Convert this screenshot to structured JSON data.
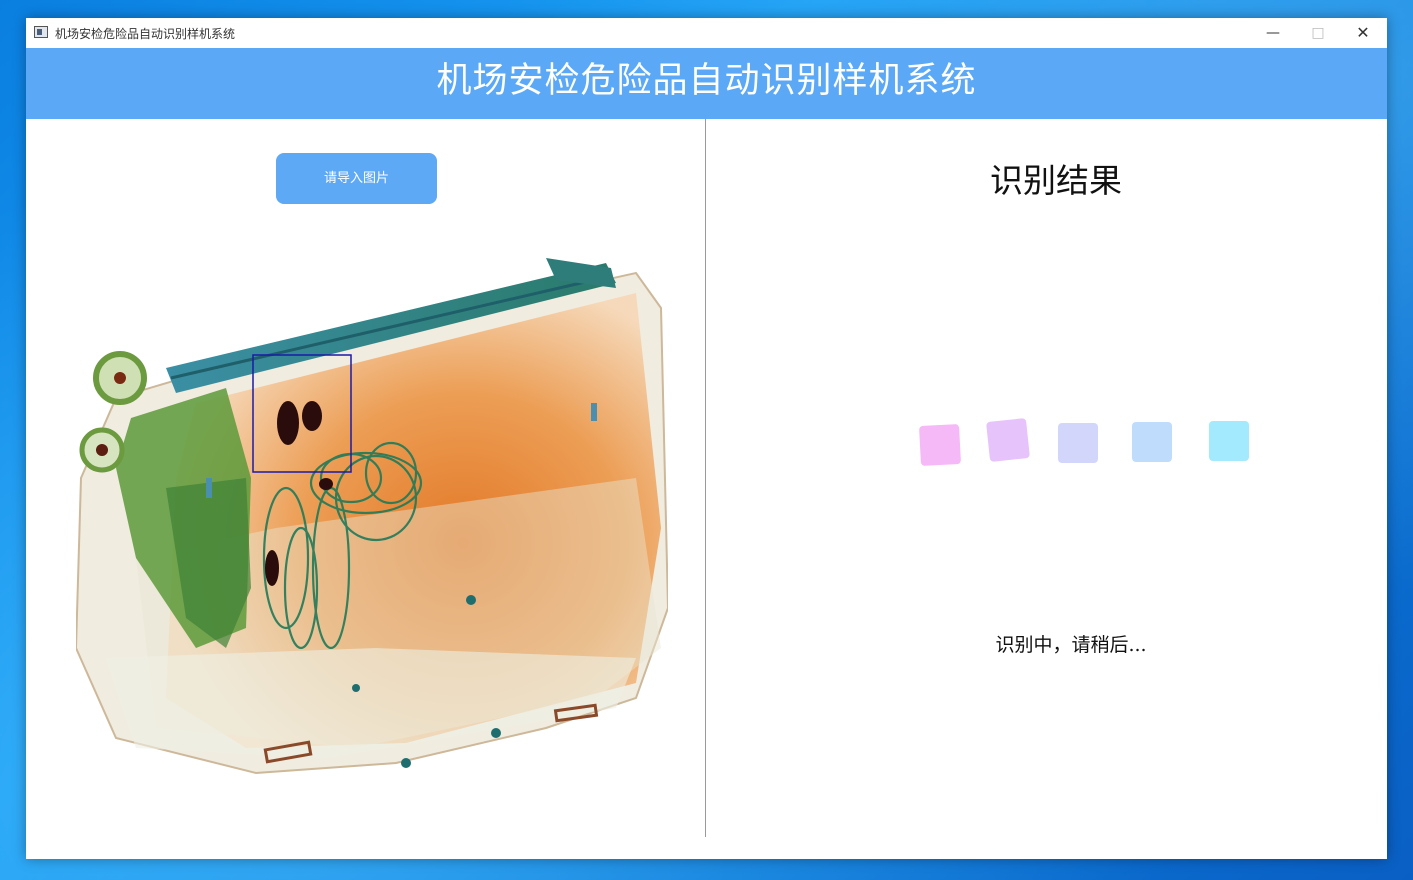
{
  "window": {
    "title": "机场安检危险品自动识别样机系统",
    "controls": {
      "minimize": "—",
      "maximize": "□",
      "close": "✕"
    }
  },
  "header": {
    "title": "机场安检危险品自动识别样机系统"
  },
  "left_panel": {
    "import_button_label": "请导入图片"
  },
  "right_panel": {
    "result_title": "识别结果",
    "loader_colors": [
      "#f5b9f7",
      "#e6c3fa",
      "#d2d6fb",
      "#bfdcfd",
      "#a3eaff"
    ],
    "status_text": "识别中，请稍后..."
  },
  "colors": {
    "banner": "#5aa8f6",
    "button": "#5ea9f6",
    "detection_box": "#1a1aa8"
  }
}
